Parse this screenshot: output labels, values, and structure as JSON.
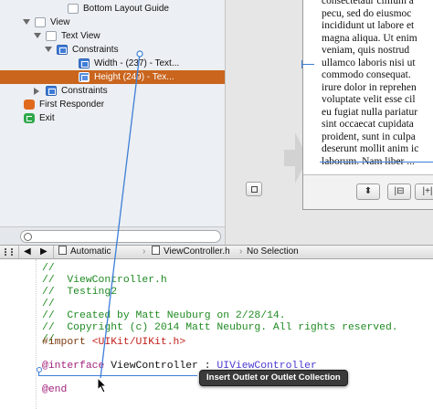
{
  "outline": {
    "items": [
      {
        "label": "Bottom Layout Guide",
        "icon": "box-icon",
        "level": 5,
        "expander": "none",
        "selected": false
      },
      {
        "label": "View",
        "icon": "view-icon",
        "level": 2,
        "expander": "down",
        "selected": false
      },
      {
        "label": "Text View",
        "icon": "view-icon",
        "level": 3,
        "expander": "down",
        "selected": false
      },
      {
        "label": "Constraints",
        "icon": "constraints-icon",
        "level": 4,
        "expander": "down",
        "selected": false
      },
      {
        "label": "Width - (237) - Text...",
        "icon": "constraint-icon",
        "level": 6,
        "expander": "none",
        "selected": false
      },
      {
        "label": "Height (249) - Tex...",
        "icon": "constraint-icon",
        "level": 6,
        "expander": "none",
        "selected": true
      },
      {
        "label": "Constraints",
        "icon": "constraints-icon",
        "level": 3,
        "expander": "right",
        "selected": false
      },
      {
        "label": "First Responder",
        "icon": "cube-icon",
        "level": 1,
        "expander": "none",
        "selected": false
      },
      {
        "label": "Exit",
        "icon": "exit-icon",
        "level": 1,
        "expander": "none",
        "selected": false
      }
    ]
  },
  "canvas": {
    "text_lines": [
      "consectetaur cillium a",
      "pecu, sed do eiusmoc",
      "incididunt ut labore et",
      "magna aliqua. Ut enim",
      "veniam, quis nostrud",
      "ullamco laboris nisi ut",
      "commodo consequat.",
      "irure dolor in reprehen",
      "voluptate velit esse cil",
      "eu fugiat nulla pariatur",
      "sint occaecat cupidata",
      "proident, sunt in culpa",
      "deserunt mollit anim ic",
      "laborum. Nam liber ..."
    ],
    "toolbar_buttons": [
      {
        "name": "align-button",
        "glyph": "⬍"
      },
      {
        "name": "pin-button",
        "glyph": "|⊟"
      },
      {
        "name": "resolve-button",
        "glyph": "|+|"
      }
    ]
  },
  "jumpbar": {
    "mode": "Automatic",
    "file": "ViewController.h",
    "symbol": "No Selection",
    "related_icon": "grid-icon"
  },
  "code": {
    "lines": [
      {
        "kind": "cmt",
        "text": "//"
      },
      {
        "kind": "cmt",
        "text": "//  ViewController.h"
      },
      {
        "kind": "cmt",
        "text": "//  Testing2"
      },
      {
        "kind": "cmt",
        "text": "//"
      },
      {
        "kind": "cmt",
        "text": "//  Created by Matt Neuburg on 2/28/14."
      },
      {
        "kind": "cmt",
        "text": "//  Copyright (c) 2014 Matt Neuburg. All rights reserved."
      },
      {
        "kind": "cmt",
        "text": "//"
      }
    ],
    "import_directive": "#import ",
    "import_path": "<UIKit/UIKit.h>",
    "interface_kw": "@interface",
    "interface_name": " ViewController : ",
    "superclass": "UIViewController",
    "end_kw": "@end"
  },
  "tooltip": "Insert Outlet or Outlet Collection",
  "colors": {
    "selection": "#c9651d",
    "connection_line": "#3d7ed8",
    "comment": "#1f8a22",
    "keyword": "#a1227b",
    "string": "#c1201a",
    "class": "#4a3ad0"
  }
}
